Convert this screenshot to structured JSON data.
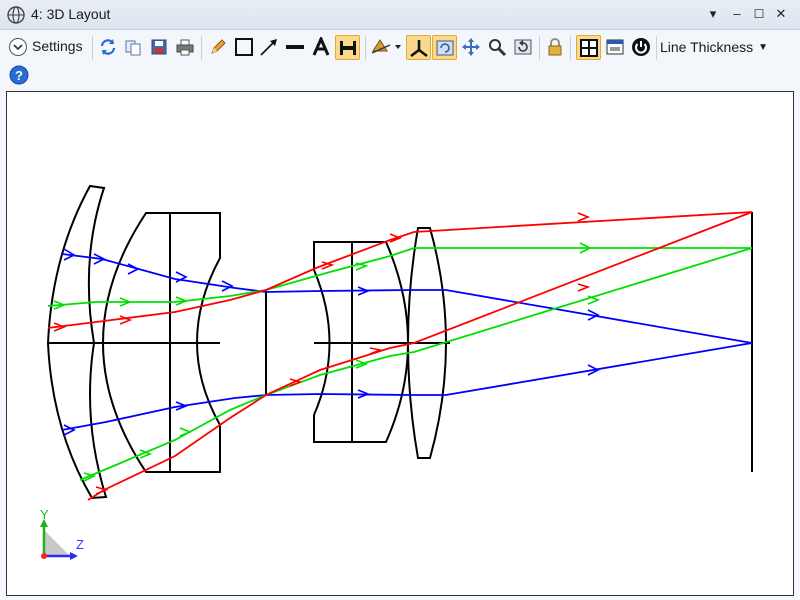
{
  "window": {
    "title": "4: 3D Layout",
    "controls": [
      "chevron-down-icon",
      "close-icon",
      "maximize-icon",
      "close-x-icon"
    ]
  },
  "toolbar": {
    "settings_label": "Settings",
    "line_thickness_label": "Line Thickness",
    "icons": [
      "refresh-icon",
      "copy-icon",
      "save-icon",
      "print-icon",
      "pencil-icon",
      "rectangle-icon",
      "arrow-icon",
      "line-icon",
      "text-icon",
      "dimension-icon",
      "rotate-view-icon",
      "axes-icon",
      "rescale-icon",
      "pan-icon",
      "zoom-icon",
      "reset-icon",
      "lock-icon",
      "layout-icon",
      "window-icon",
      "power-icon",
      "help-icon"
    ]
  },
  "plot": {
    "axis_y_label": "Y",
    "axis_z_label": "Z",
    "ray_colors": {
      "field1": "#0000ff",
      "field2": "#00ee00",
      "field3": "#ff0000"
    },
    "lens_color": "#000000"
  }
}
